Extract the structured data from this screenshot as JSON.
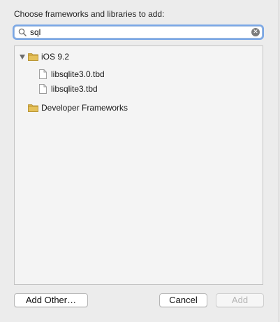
{
  "dialog": {
    "prompt": "Choose frameworks and libraries to add:"
  },
  "search": {
    "value": "sql"
  },
  "tree": {
    "groups": [
      {
        "label": "iOS 9.2",
        "expanded": true,
        "items": [
          {
            "label": "libsqlite3.0.tbd"
          },
          {
            "label": "libsqlite3.tbd"
          }
        ]
      },
      {
        "label": "Developer Frameworks",
        "expanded": false
      }
    ]
  },
  "buttons": {
    "add_other": "Add Other…",
    "cancel": "Cancel",
    "add": "Add"
  },
  "colors": {
    "focus_ring": "#7aa7e6",
    "folder": "#d9b24a"
  }
}
